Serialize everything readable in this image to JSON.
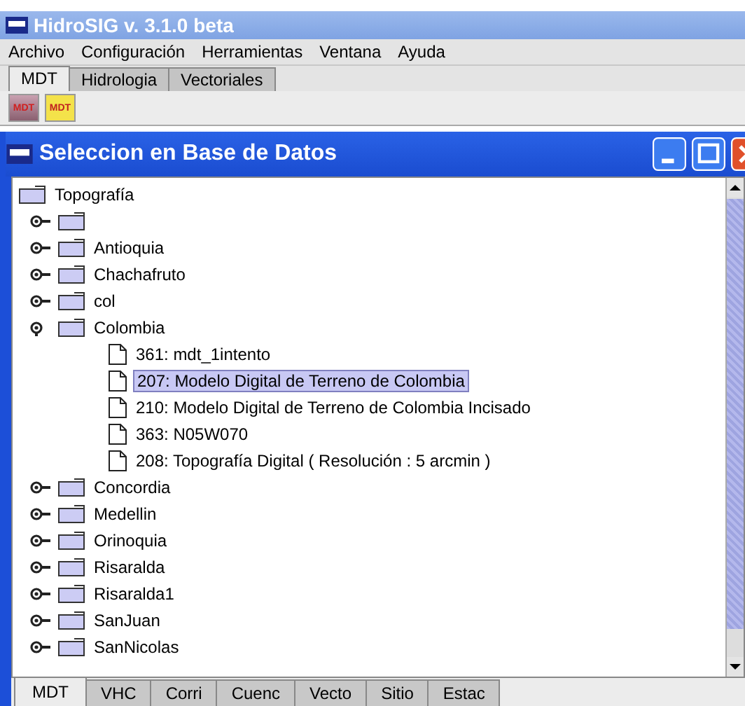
{
  "window": {
    "title": "HidroSIG v. 3.1.0 beta"
  },
  "menu": [
    "Archivo",
    "Configuración",
    "Herramientas",
    "Ventana",
    "Ayuda"
  ],
  "tabs": [
    {
      "label": "MDT",
      "selected": true
    },
    {
      "label": "Hidrologia",
      "selected": false
    },
    {
      "label": "Vectoriales",
      "selected": false
    }
  ],
  "toolbar": [
    {
      "kind": "database",
      "label": "MDT"
    },
    {
      "kind": "folder",
      "label": "MDT"
    }
  ],
  "dialog": {
    "title": "Seleccion en Base de Datos",
    "tree": {
      "label": "Topografía",
      "children": [
        {
          "expanded": false
        },
        {
          "label": "Antioquia",
          "expanded": false
        },
        {
          "label": "Chachafruto",
          "expanded": false
        },
        {
          "label": "col",
          "expanded": false
        },
        {
          "label": "Colombia",
          "expanded": true,
          "children": [
            {
              "label": "361: mdt_1intento",
              "selected": false
            },
            {
              "label": "207: Modelo Digital de Terreno de Colombia",
              "selected": true
            },
            {
              "label": "210: Modelo Digital de Terreno de Colombia Incisado",
              "selected": false
            },
            {
              "label": "363: N05W070",
              "selected": false
            },
            {
              "label": "208: Topografía Digital ( Resolución : 5 arcmin )",
              "selected": false
            }
          ]
        },
        {
          "label": "Concordia",
          "expanded": false
        },
        {
          "label": "Medellin",
          "expanded": false
        },
        {
          "label": "Orinoquia",
          "expanded": false
        },
        {
          "label": "Risaralda",
          "expanded": false
        },
        {
          "label": "Risaralda1",
          "expanded": false
        },
        {
          "label": "SanJuan",
          "expanded": false
        },
        {
          "label": "SanNicolas",
          "expanded": false
        }
      ]
    },
    "bottom_tabs": [
      {
        "label": "MDT",
        "selected": true
      },
      {
        "label": "VHC",
        "selected": false
      },
      {
        "label": "Corri",
        "selected": false
      },
      {
        "label": "Cuenc",
        "selected": false
      },
      {
        "label": "Vecto",
        "selected": false
      },
      {
        "label": "Sitio",
        "selected": false
      },
      {
        "label": "Estac",
        "selected": false
      }
    ]
  }
}
